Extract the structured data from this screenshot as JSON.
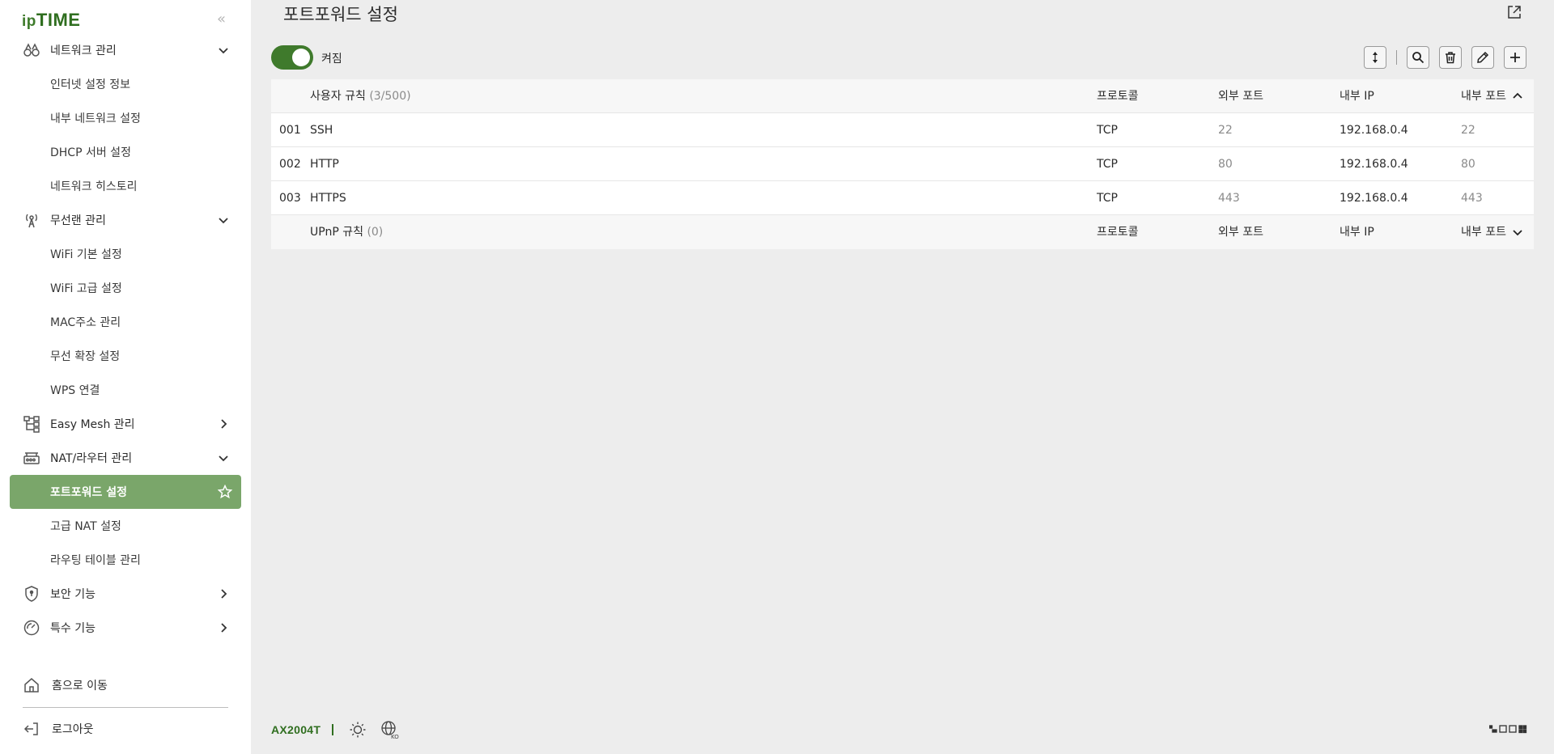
{
  "brand": {
    "ip": "ip",
    "time": "TIME"
  },
  "sidebar": {
    "collapse_symbol": "«",
    "sections": [
      {
        "label": "네트워크 관리",
        "icon": "binoculars-icon",
        "expanded": true,
        "children": [
          "인터넷 설정 정보",
          "내부 네트워크 설정",
          "DHCP 서버 설정",
          "네트워크 히스토리"
        ]
      },
      {
        "label": "무선랜 관리",
        "icon": "antenna-icon",
        "expanded": true,
        "children": [
          "WiFi 기본 설정",
          "WiFi 고급 설정",
          "MAC주소 관리",
          "무선 확장 설정",
          "WPS 연결"
        ]
      },
      {
        "label": "Easy Mesh 관리",
        "icon": "mesh-icon",
        "expanded": false,
        "children": []
      },
      {
        "label": "NAT/라우터 관리",
        "icon": "router-icon",
        "expanded": true,
        "children": [
          "포트포워드 설정",
          "고급 NAT 설정",
          "라우팅 테이블 관리"
        ]
      },
      {
        "label": "보안 기능",
        "icon": "shield-icon",
        "expanded": false,
        "children": []
      },
      {
        "label": "특수 기능",
        "icon": "gauge-icon",
        "expanded": false,
        "children": []
      }
    ],
    "active_item": "포트포워드 설정",
    "home_label": "홈으로 이동",
    "logout_label": "로그아웃"
  },
  "main": {
    "title": "포트포워드 설정",
    "toggle_label": "켜짐",
    "toggle_on": true,
    "table": {
      "user_rules": {
        "label": "사용자 규칙",
        "count": "(3/500)",
        "columns": {
          "protocol": "프로토콜",
          "ext_port": "외부 포트",
          "ip": "내부 IP",
          "int_port": "내부 포트"
        },
        "rows": [
          {
            "num": "001",
            "name": "SSH",
            "protocol": "TCP",
            "ext_port": "22",
            "ip": "192.168.0.4",
            "int_port": "22"
          },
          {
            "num": "002",
            "name": "HTTP",
            "protocol": "TCP",
            "ext_port": "80",
            "ip": "192.168.0.4",
            "int_port": "80"
          },
          {
            "num": "003",
            "name": "HTTPS",
            "protocol": "TCP",
            "ext_port": "443",
            "ip": "192.168.0.4",
            "int_port": "443"
          }
        ]
      },
      "upnp_rules": {
        "label": "UPnP 규칙",
        "count": "(0)",
        "columns": {
          "protocol": "프로토콜",
          "ext_port": "외부 포트",
          "ip": "내부 IP",
          "int_port": "내부 포트"
        }
      }
    }
  },
  "footer": {
    "model": "AX2004T",
    "lang_code": "KO"
  },
  "colors": {
    "brand_green": "#2f6e1f",
    "toggle_green": "#3f7a2c",
    "active_item_bg": "#7aa66a",
    "background": "#ededed"
  }
}
